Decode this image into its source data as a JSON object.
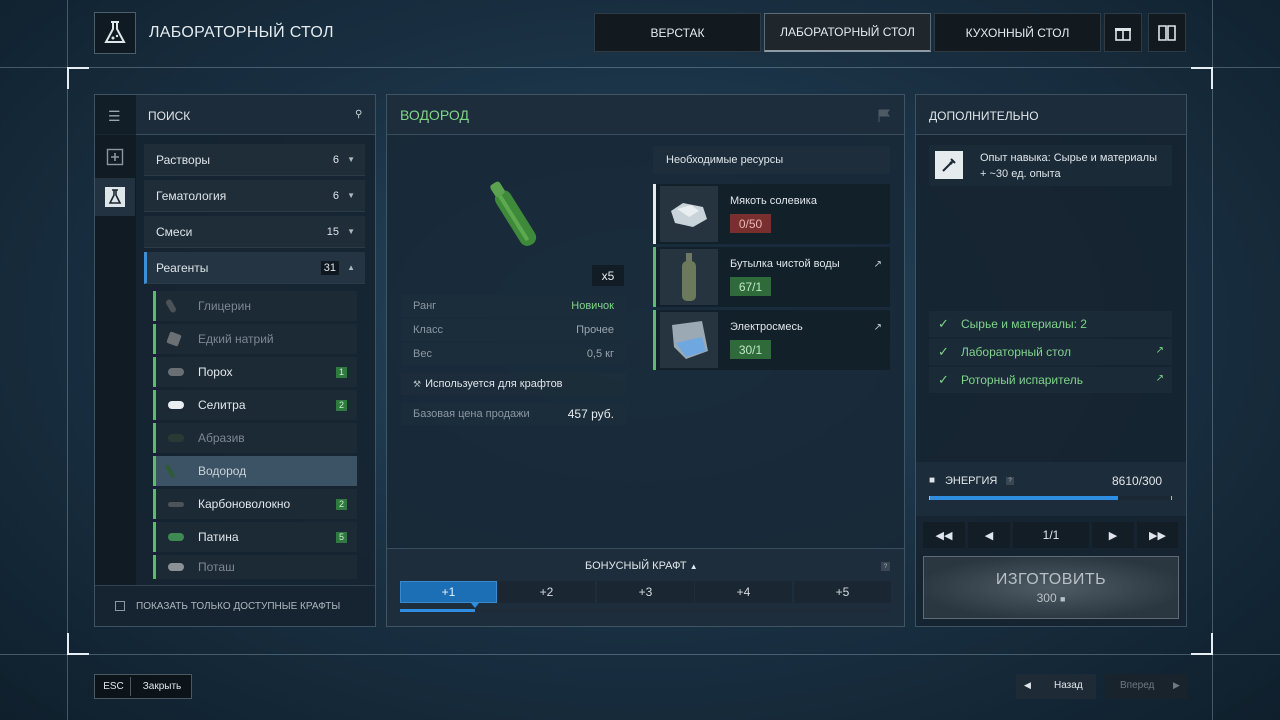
{
  "header": {
    "title": "ЛАБОРАТОРНЫЙ СТОЛ",
    "tabs": [
      {
        "label": "ВЕРСТАК"
      },
      {
        "label": "ЛАБОРАТОРНЫЙ СТОЛ"
      },
      {
        "label": "КУХОННЫЙ СТОЛ"
      }
    ]
  },
  "left": {
    "search_label": "ПОИСК",
    "categories": [
      {
        "label": "Растворы",
        "count": "6"
      },
      {
        "label": "Гематология",
        "count": "6"
      },
      {
        "label": "Смеси",
        "count": "15"
      },
      {
        "label": "Реагенты",
        "count": "31"
      }
    ],
    "items": [
      {
        "label": "Глицерин",
        "badge": ""
      },
      {
        "label": "Едкий натрий",
        "badge": ""
      },
      {
        "label": "Порох",
        "badge": "1"
      },
      {
        "label": "Селитра",
        "badge": "2"
      },
      {
        "label": "Абразив",
        "badge": ""
      },
      {
        "label": "Водород",
        "badge": ""
      },
      {
        "label": "Карбоноволокно",
        "badge": "2"
      },
      {
        "label": "Патина",
        "badge": "5"
      },
      {
        "label": "Поташ",
        "badge": ""
      }
    ],
    "only_available_label": "ПОКАЗАТЬ ТОЛЬКО ДОСТУПНЫЕ КРАФТЫ"
  },
  "middle": {
    "item_title": "ВОДОРОД",
    "quantity": "x5",
    "props": [
      {
        "key": "Ранг",
        "value": "Новичок"
      },
      {
        "key": "Класс",
        "value": "Прочее"
      },
      {
        "key": "Вес",
        "value": "0,5 кг"
      }
    ],
    "used_for": "Используется для крафтов",
    "price_label": "Базовая цена продажи",
    "price_value": "457 руб.",
    "resources_title": "Необходимые ресурсы",
    "resources": [
      {
        "name": "Мякоть солевика",
        "qty": "0/50"
      },
      {
        "name": "Бутылка чистой воды",
        "qty": "67/1"
      },
      {
        "name": "Электросмесь",
        "qty": "30/1"
      }
    ],
    "bonus_title": "БОНУСНЫЙ КРАФТ",
    "bonus_options": [
      "+1",
      "+2",
      "+3",
      "+4",
      "+5"
    ]
  },
  "right": {
    "title": "ДОПОЛНИТЕЛЬНО",
    "skill_line1": "Опыт навыка: Сырье и материалы",
    "skill_line2": "+ ~30 ед. опыта",
    "requirements": [
      {
        "label": "Сырье и материалы: 2"
      },
      {
        "label": "Лабораторный стол"
      },
      {
        "label": "Роторный испаритель"
      }
    ],
    "energy_label": "ЭНЕРГИЯ",
    "energy_value": "8610/300",
    "pager": "1/1",
    "craft_label": "ИЗГОТОВИТЬ",
    "craft_cost": "300"
  },
  "footer": {
    "esc_key": "ESC",
    "close_label": "Закрыть",
    "back_label": "Назад",
    "forward_label": "Вперед"
  }
}
